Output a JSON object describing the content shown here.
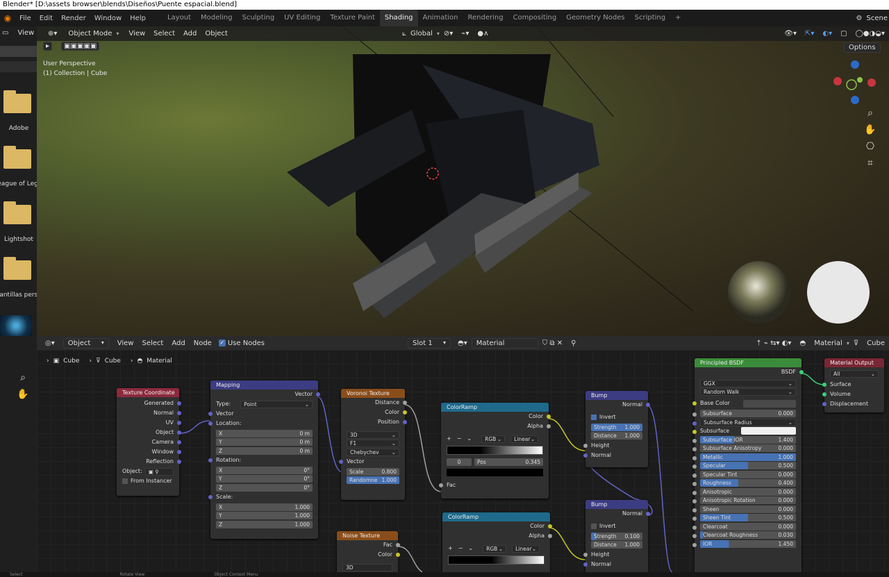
{
  "window_title": "Blender* [D:\\assets browser\\blends\\Diseños\\Puente espacial.blend]",
  "menus": [
    "File",
    "Edit",
    "Render",
    "Window",
    "Help"
  ],
  "workspaces": [
    "Layout",
    "Modeling",
    "Sculpting",
    "UV Editing",
    "Texture Paint",
    "Shading",
    "Animation",
    "Rendering",
    "Compositing",
    "Geometry Nodes",
    "Scripting"
  ],
  "active_workspace": "Shading",
  "scene_label": "Scene",
  "sidebar": {
    "view_label": "View",
    "folders": [
      "Adobe",
      "eague of Leg.",
      "Lightshot",
      "lantillas pers."
    ]
  },
  "viewport": {
    "mode": "Object Mode",
    "menus": [
      "View",
      "Select",
      "Add",
      "Object"
    ],
    "orientation": "Global",
    "options": "Options",
    "perspective_text": "User Perspective",
    "collection_text": "(1) Collection | Cube"
  },
  "node_header": {
    "editor_label": "V",
    "object_mode": "Object",
    "menus": [
      "View",
      "Select",
      "Add",
      "Node"
    ],
    "use_nodes": "Use Nodes",
    "slot": "Slot 1",
    "material": "Material",
    "right_material": "Material",
    "right_object": "Cube"
  },
  "breadcrumb": [
    "Cube",
    "Cube",
    "Material"
  ],
  "nodes": {
    "tex_coord": {
      "title": "Texture Coordinate",
      "outputs": [
        "Generated",
        "Normal",
        "UV",
        "Object",
        "Camera",
        "Window",
        "Reflection"
      ],
      "object_label": "Object:",
      "from_instancer": "From Instancer"
    },
    "mapping": {
      "title": "Mapping",
      "output": "Vector",
      "type_label": "Type:",
      "type_value": "Point",
      "vector": "Vector",
      "location": "Location:",
      "loc": [
        [
          "X",
          "0 m"
        ],
        [
          "Y",
          "0 m"
        ],
        [
          "Z",
          "0 m"
        ]
      ],
      "rotation": "Rotation:",
      "rot": [
        [
          "X",
          "0°"
        ],
        [
          "Y",
          "0°"
        ],
        [
          "Z",
          "0°"
        ]
      ],
      "scale": "Scale:",
      "scl": [
        [
          "X",
          "1.000"
        ],
        [
          "Y",
          "1.000"
        ],
        [
          "Z",
          "1.000"
        ]
      ]
    },
    "voronoi": {
      "title": "Voronoi Texture",
      "outputs": [
        "Distance",
        "Color",
        "Position"
      ],
      "dim": "3D",
      "feature": "F1",
      "metric": "Chebychev",
      "vector": "Vector",
      "scale_label": "Scale",
      "scale_value": "0.800",
      "random_label": "Randomne",
      "random_value": "1.000"
    },
    "ramp1": {
      "title": "ColorRamp",
      "outputs": [
        "Color",
        "Alpha"
      ],
      "mode": "RGB",
      "interp": "Linear",
      "index": "0",
      "pos_label": "Pos",
      "pos_value": "0.345",
      "input": "Fac"
    },
    "bump1": {
      "title": "Bump",
      "output": "Normal",
      "invert": "Invert",
      "strength_label": "Strength",
      "strength_value": "1.000",
      "distance_label": "Distance",
      "distance_value": "1.000",
      "inputs": [
        "Height",
        "Normal"
      ]
    },
    "bump2": {
      "title": "Bump",
      "output": "Normal",
      "invert": "Invert",
      "strength_label": "Strength",
      "strength_value": "0.100",
      "distance_label": "Distance",
      "distance_value": "1.000",
      "inputs": [
        "Height",
        "Normal"
      ]
    },
    "ramp2": {
      "title": "ColorRamp",
      "outputs": [
        "Color",
        "Alpha"
      ],
      "mode": "RGB",
      "interp": "Linear"
    },
    "noise": {
      "title": "Noise Texture",
      "outputs": [
        "Fac",
        "Color"
      ],
      "dim": "3D"
    },
    "bsdf": {
      "title": "Principled BSDF",
      "output": "BSDF",
      "dist": "GGX",
      "sss": "Random Walk",
      "base_color": "Base Color",
      "fields": [
        [
          "Subsurface",
          "0.000",
          0
        ],
        [
          "Subsurface Radius",
          "",
          -1
        ],
        [
          "Subsurface Colo",
          "",
          -2
        ],
        [
          "Subsurface IOR",
          "1.400",
          0.35
        ],
        [
          "Subsurface Anisotropy",
          "0.000",
          0
        ],
        [
          "Metallic",
          "1.000",
          1
        ],
        [
          "Specular",
          "0.500",
          0.5
        ],
        [
          "Specular Tint",
          "0.000",
          0
        ],
        [
          "Roughness",
          "0.400",
          0.4
        ],
        [
          "Anisotropic",
          "0.000",
          0
        ],
        [
          "Anisotropic Rotation",
          "0.000",
          0
        ],
        [
          "Sheen",
          "0.000",
          0
        ],
        [
          "Sheen Tint",
          "0.500",
          0.5
        ],
        [
          "Clearcoat",
          "0.000",
          0
        ],
        [
          "Clearcoat Roughness",
          "0.030",
          0.03
        ],
        [
          "IOR",
          "1.450",
          0.3
        ]
      ]
    },
    "output": {
      "title": "Material Output",
      "target": "All",
      "inputs": [
        "Surface",
        "Volume",
        "Displacement"
      ]
    }
  },
  "status": {
    "select": "Select",
    "rotate": "Rotate View",
    "context": "Object Context Menu"
  }
}
